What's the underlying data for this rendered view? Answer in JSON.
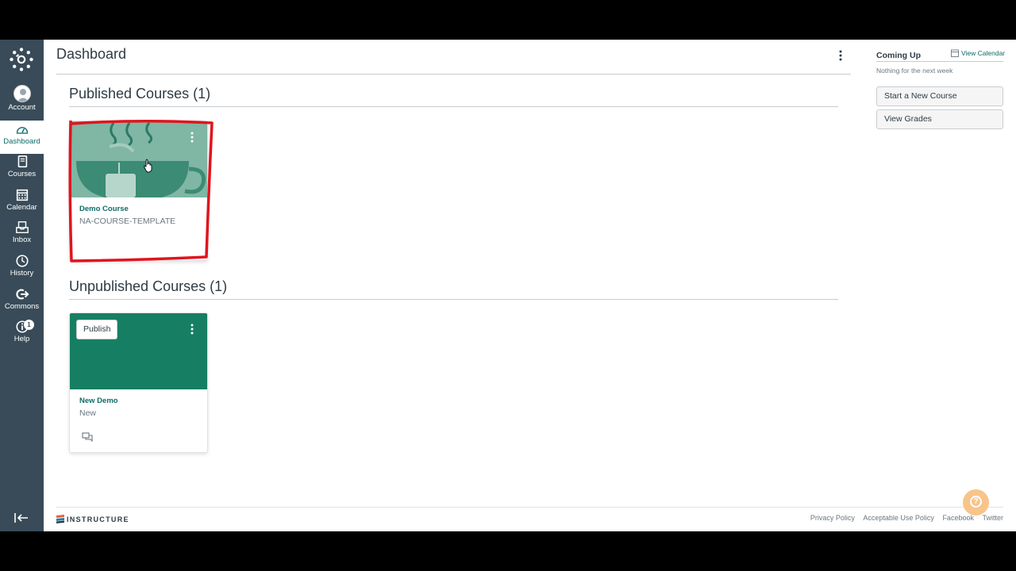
{
  "nav": {
    "items": [
      {
        "label": "Account"
      },
      {
        "label": "Dashboard"
      },
      {
        "label": "Courses"
      },
      {
        "label": "Calendar"
      },
      {
        "label": "Inbox"
      },
      {
        "label": "History"
      },
      {
        "label": "Commons"
      },
      {
        "label": "Help",
        "badge": "1"
      }
    ]
  },
  "header": {
    "title": "Dashboard"
  },
  "published": {
    "title": "Published Courses (1)",
    "courses": [
      {
        "name": "Demo Course",
        "code": "NA-COURSE-TEMPLATE",
        "hero_color": "#7FB6A4",
        "image_text": "TEA"
      }
    ]
  },
  "unpublished": {
    "title": "Unpublished Courses (1)",
    "courses": [
      {
        "name": "New Demo",
        "code": "New",
        "hero_color": "#167F63",
        "publish_label": "Publish"
      }
    ]
  },
  "sidebar": {
    "coming_up": "Coming Up",
    "view_calendar": "View Calendar",
    "nothing": "Nothing for the next week",
    "buttons": [
      "Start a New Course",
      "View Grades"
    ]
  },
  "footer": {
    "brand": "INSTRUCTURE",
    "links": [
      "Privacy Policy",
      "Acceptable Use Policy",
      "Facebook",
      "Twitter"
    ]
  },
  "colors": {
    "nav_bg": "#394B58",
    "accent": "#0E6B65",
    "annotation": "#E0141E",
    "help_fab": "#F8C48A"
  }
}
